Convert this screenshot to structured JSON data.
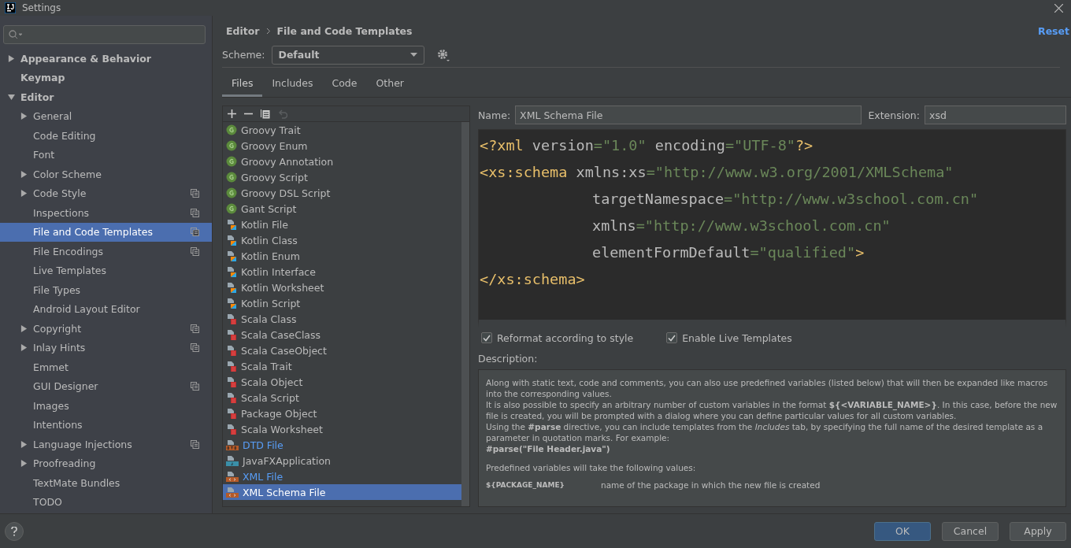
{
  "window": {
    "title": "Settings"
  },
  "sidebar": {
    "items": [
      {
        "label": "Appearance & Behavior",
        "expandable": true,
        "expanded": false,
        "project_level": false,
        "selected": false
      },
      {
        "label": "Keymap",
        "expandable": false,
        "project_level": false,
        "selected": false
      },
      {
        "label": "Editor",
        "expandable": true,
        "expanded": true,
        "project_level": false,
        "selected": false,
        "children": [
          {
            "label": "General",
            "expandable": true,
            "project_level": false,
            "selected": false
          },
          {
            "label": "Code Editing",
            "expandable": false,
            "project_level": false,
            "selected": false
          },
          {
            "label": "Font",
            "expandable": false,
            "project_level": false,
            "selected": false
          },
          {
            "label": "Color Scheme",
            "expandable": true,
            "project_level": false,
            "selected": false
          },
          {
            "label": "Code Style",
            "expandable": true,
            "project_level": true,
            "selected": false
          },
          {
            "label": "Inspections",
            "expandable": false,
            "project_level": true,
            "selected": false
          },
          {
            "label": "File and Code Templates",
            "expandable": false,
            "project_level": true,
            "selected": true
          },
          {
            "label": "File Encodings",
            "expandable": false,
            "project_level": true,
            "selected": false
          },
          {
            "label": "Live Templates",
            "expandable": false,
            "project_level": false,
            "selected": false
          },
          {
            "label": "File Types",
            "expandable": false,
            "project_level": false,
            "selected": false
          },
          {
            "label": "Android Layout Editor",
            "expandable": false,
            "project_level": false,
            "selected": false
          },
          {
            "label": "Copyright",
            "expandable": true,
            "project_level": true,
            "selected": false
          },
          {
            "label": "Inlay Hints",
            "expandable": true,
            "project_level": true,
            "selected": false
          },
          {
            "label": "Emmet",
            "expandable": false,
            "project_level": false,
            "selected": false
          },
          {
            "label": "GUI Designer",
            "expandable": false,
            "project_level": true,
            "selected": false
          },
          {
            "label": "Images",
            "expandable": false,
            "project_level": false,
            "selected": false
          },
          {
            "label": "Intentions",
            "expandable": false,
            "project_level": false,
            "selected": false
          },
          {
            "label": "Language Injections",
            "expandable": true,
            "project_level": true,
            "selected": false
          },
          {
            "label": "Proofreading",
            "expandable": true,
            "project_level": false,
            "selected": false
          },
          {
            "label": "TextMate Bundles",
            "expandable": false,
            "project_level": false,
            "selected": false
          },
          {
            "label": "TODO",
            "expandable": false,
            "project_level": false,
            "selected": false
          }
        ]
      }
    ]
  },
  "breadcrumb": [
    "Editor",
    "File and Code Templates"
  ],
  "reset": "Reset",
  "scheme": {
    "label": "Scheme:",
    "value": "Default"
  },
  "tabs": [
    {
      "label": "Files",
      "selected": true
    },
    {
      "label": "Includes",
      "selected": false
    },
    {
      "label": "Code",
      "selected": false
    },
    {
      "label": "Other",
      "selected": false
    }
  ],
  "templates": [
    {
      "label": "Groovy Trait",
      "kind": "groovy",
      "modified": false,
      "selected": false
    },
    {
      "label": "Groovy Enum",
      "kind": "groovy",
      "modified": false,
      "selected": false
    },
    {
      "label": "Groovy Annotation",
      "kind": "groovy",
      "modified": false,
      "selected": false
    },
    {
      "label": "Groovy Script",
      "kind": "groovy",
      "modified": false,
      "selected": false
    },
    {
      "label": "Groovy DSL Script",
      "kind": "groovy",
      "modified": false,
      "selected": false
    },
    {
      "label": "Gant Script",
      "kind": "groovy",
      "modified": false,
      "selected": false
    },
    {
      "label": "Kotlin File",
      "kind": "kotlin",
      "modified": false,
      "selected": false
    },
    {
      "label": "Kotlin Class",
      "kind": "kotlin",
      "modified": false,
      "selected": false
    },
    {
      "label": "Kotlin Enum",
      "kind": "kotlin",
      "modified": false,
      "selected": false
    },
    {
      "label": "Kotlin Interface",
      "kind": "kotlin",
      "modified": false,
      "selected": false
    },
    {
      "label": "Kotlin Worksheet",
      "kind": "kotlin",
      "modified": false,
      "selected": false
    },
    {
      "label": "Kotlin Script",
      "kind": "kotlin",
      "modified": false,
      "selected": false
    },
    {
      "label": "Scala Class",
      "kind": "scala",
      "modified": false,
      "selected": false
    },
    {
      "label": "Scala CaseClass",
      "kind": "scala",
      "modified": false,
      "selected": false
    },
    {
      "label": "Scala CaseObject",
      "kind": "scala",
      "modified": false,
      "selected": false
    },
    {
      "label": "Scala Trait",
      "kind": "scala",
      "modified": false,
      "selected": false
    },
    {
      "label": "Scala Object",
      "kind": "scala",
      "modified": false,
      "selected": false
    },
    {
      "label": "Scala Script",
      "kind": "scala",
      "modified": false,
      "selected": false
    },
    {
      "label": "Package Object",
      "kind": "scala",
      "modified": false,
      "selected": false
    },
    {
      "label": "Scala Worksheet",
      "kind": "scala",
      "modified": false,
      "selected": false
    },
    {
      "label": "DTD File",
      "kind": "dtd",
      "modified": true,
      "selected": false
    },
    {
      "label": "JavaFXApplication",
      "kind": "javafx",
      "modified": false,
      "selected": false
    },
    {
      "label": "XML File",
      "kind": "xml",
      "modified": true,
      "selected": false
    },
    {
      "label": "XML Schema File",
      "kind": "xml",
      "modified": false,
      "selected": true
    }
  ],
  "name": {
    "label": "Name:",
    "value": "XML Schema File"
  },
  "extension": {
    "label": "Extension:",
    "value": "xsd"
  },
  "code": [
    {
      "indented": false,
      "tokens": [
        {
          "kind": "tag",
          "text": "<?xml "
        },
        {
          "kind": "attr",
          "text": "version"
        },
        {
          "kind": "value",
          "text": "=\"1.0\" "
        },
        {
          "kind": "attr",
          "text": "encoding"
        },
        {
          "kind": "value",
          "text": "=\"UTF-8\""
        },
        {
          "kind": "tag",
          "text": "?>"
        }
      ]
    },
    {
      "indented": false,
      "tokens": [
        {
          "kind": "tag",
          "text": "<xs:schema "
        },
        {
          "kind": "attr",
          "text": "xmlns:xs"
        },
        {
          "kind": "value",
          "text": "=\"http://www.w3.org/2001/XMLSchema\""
        }
      ]
    },
    {
      "indented": true,
      "tokens": [
        {
          "kind": "attr",
          "text": "targetNamespace"
        },
        {
          "kind": "value",
          "text": "=\"http://www.w3school.com.cn\""
        }
      ]
    },
    {
      "indented": true,
      "tokens": [
        {
          "kind": "attr",
          "text": "xmlns"
        },
        {
          "kind": "value",
          "text": "=\"http://www.w3school.com.cn\""
        }
      ]
    },
    {
      "indented": true,
      "tokens": [
        {
          "kind": "attr",
          "text": "elementFormDefault"
        },
        {
          "kind": "value",
          "text": "=\"qualified\""
        },
        {
          "kind": "tag",
          "text": ">"
        }
      ]
    },
    {
      "indented": false,
      "tokens": [
        {
          "kind": "tag",
          "text": "</xs:schema>"
        }
      ]
    }
  ],
  "options": [
    {
      "label": "Reformat according to style",
      "checked": true
    },
    {
      "label": "Enable Live Templates",
      "checked": true
    }
  ],
  "description": {
    "label": "Description:",
    "paragraphs": [
      "Along with static text, code and comments, you can also use predefined variables (listed below) that will then be expanded like macros into the corresponding values.",
      "It is also possible to specify an arbitrary number of custom variables in the format **${<VARIABLE_NAME>}**. In this case, before the new file is created, you will be prompted with a dialog where you can define particular values for all custom variables.",
      "Using the **#parse** directive, you can include templates from the *Includes* tab, by specifying the full name of the desired template as a parameter in quotation marks. For example:",
      "**#parse(\"File Header.java\")**"
    ],
    "note": "Predefined variables will take the following values:",
    "variables": [
      {
        "name": "${PACKAGE_NAME}",
        "meaning": "name of the package in which the new file is created"
      }
    ]
  },
  "buttons": [
    {
      "label": "OK",
      "default": true
    },
    {
      "label": "Cancel",
      "default": false
    },
    {
      "label": "Apply",
      "default": false
    }
  ]
}
